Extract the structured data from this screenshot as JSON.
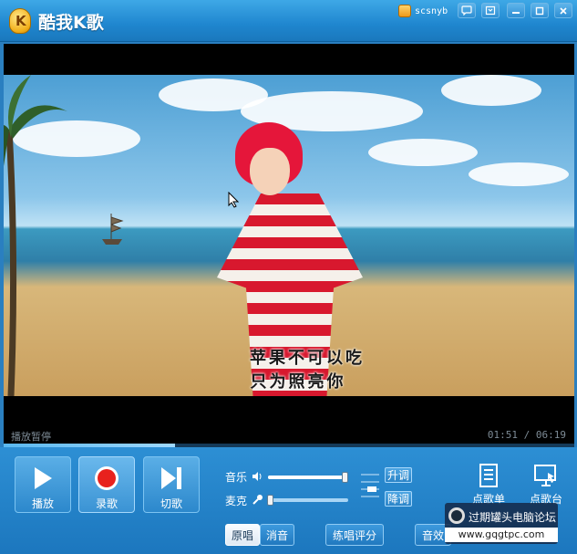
{
  "app": {
    "title": "酷我K歌",
    "logo_letter": "K",
    "username": "scsnyb"
  },
  "window_controls": [
    "chat-icon",
    "skin-icon",
    "minimize-icon",
    "maximize-icon",
    "close-icon"
  ],
  "video": {
    "lyric_line_1": "苹果不可以吃",
    "lyric_line_2": "只为照亮你",
    "status": "播放暂停",
    "time": "01:51 / 06:19",
    "progress": 0.3
  },
  "controls": {
    "play_label": "播放",
    "record_label": "录歌",
    "next_label": "切歌",
    "music_label": "音乐",
    "mic_label": "麦克",
    "music_volume": 0.97,
    "mic_volume": 0.03,
    "key_up_label": "升调",
    "key_down_label": "降调",
    "playlist_label": "点歌单",
    "song_station_label": "点歌台",
    "original_label": "原唱",
    "mute_label": "消音",
    "practice_label": "练唱评分",
    "effects_label": "音效"
  },
  "watermark": {
    "line1": "过期罐头电脑论坛",
    "line2": "www.gqgtpc.com"
  },
  "colors": {
    "accent": "#2a7fc0",
    "record_red": "#e8211d"
  }
}
